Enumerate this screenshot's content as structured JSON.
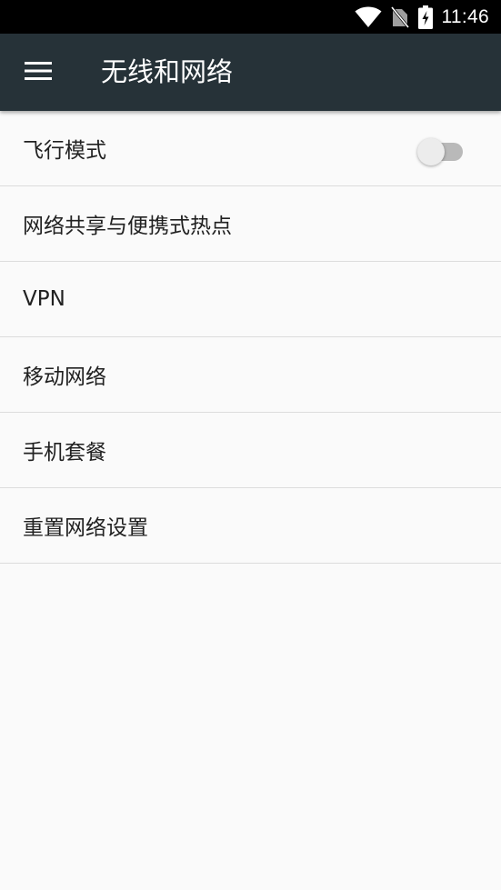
{
  "status_bar": {
    "time": "11:46",
    "icons": [
      "wifi-icon",
      "no-sim-icon",
      "battery-charging-icon"
    ]
  },
  "app_bar": {
    "menu_icon": "menu-icon",
    "title": "无线和网络"
  },
  "settings": {
    "items": [
      {
        "label": "飞行模式",
        "has_toggle": true,
        "toggle_on": false
      },
      {
        "label": "网络共享与便携式热点"
      },
      {
        "label": "VPN"
      },
      {
        "label": "移动网络"
      },
      {
        "label": "手机套餐"
      },
      {
        "label": "重置网络设置"
      }
    ]
  },
  "colors": {
    "status_bar": "#000000",
    "app_bar": "#263238",
    "background": "#fafafa",
    "text_primary": "#212121",
    "divider": "#dcdcdc"
  }
}
